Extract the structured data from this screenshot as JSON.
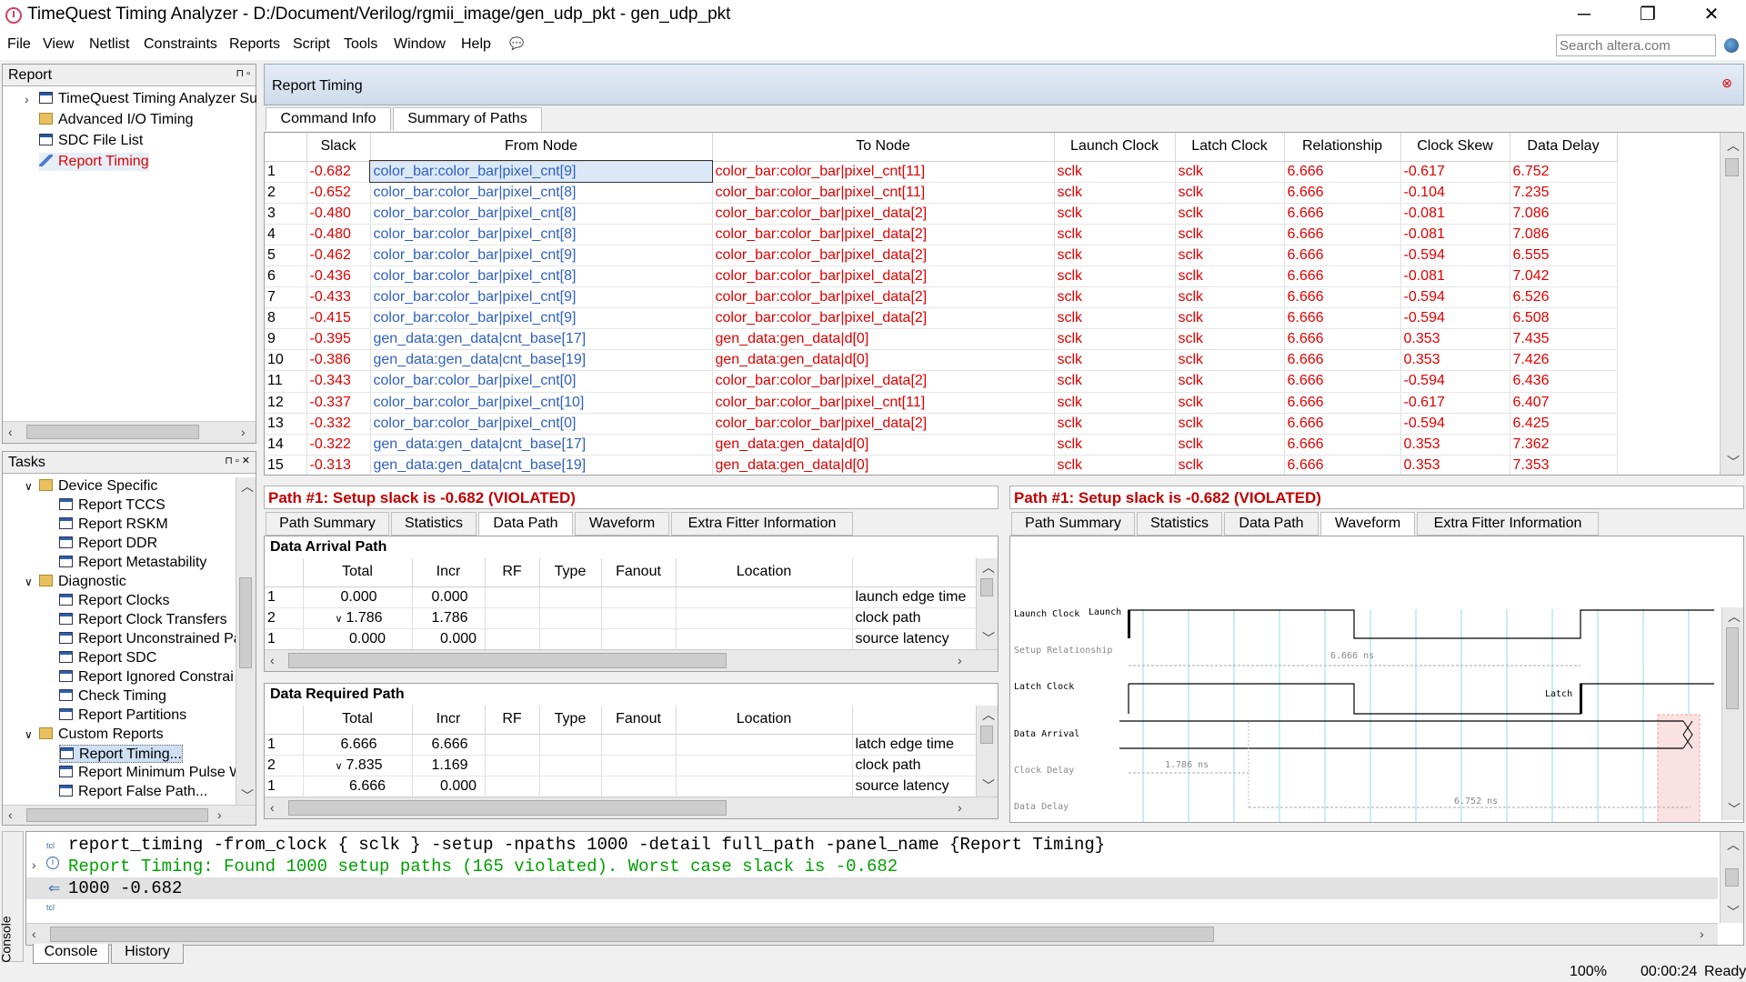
{
  "window": {
    "title": "TimeQuest Timing Analyzer - D:/Document/Verilog/rgmii_image/gen_udp_pkt - gen_udp_pkt",
    "minimize": "─",
    "maximize": "❐",
    "close": "✕"
  },
  "menu": [
    "File",
    "View",
    "Netlist",
    "Constraints",
    "Reports",
    "Script",
    "Tools",
    "Window",
    "Help"
  ],
  "search": {
    "placeholder": "Search altera.com"
  },
  "report_panel": {
    "title": "Report",
    "items": [
      "TimeQuest Timing Analyzer Su",
      "Advanced I/O Timing",
      "SDC File List",
      "Report Timing"
    ]
  },
  "tasks_panel": {
    "title": "Tasks",
    "groups": [
      {
        "label": "Device Specific",
        "items": [
          "Report TCCS",
          "Report RSKM",
          "Report DDR",
          "Report Metastability"
        ]
      },
      {
        "label": "Diagnostic",
        "items": [
          "Report Clocks",
          "Report Clock Transfers",
          "Report Unconstrained Pa",
          "Report SDC",
          "Report Ignored Constrai",
          "Check Timing",
          "Report Partitions"
        ]
      },
      {
        "label": "Custom Reports",
        "items": [
          "Report Timing...",
          "Report Minimum Pulse W",
          "Report False Path..."
        ]
      }
    ]
  },
  "main": {
    "title": "Report Timing",
    "tabs": [
      "Command Info",
      "Summary of Paths"
    ]
  },
  "summary": {
    "columns": [
      "",
      "Slack",
      "From Node",
      "To Node",
      "Launch Clock",
      "Latch Clock",
      "Relationship",
      "Clock Skew",
      "Data Delay"
    ],
    "rows": [
      [
        "1",
        "-0.682",
        "color_bar:color_bar|pixel_cnt[9]",
        "color_bar:color_bar|pixel_cnt[11]",
        "sclk",
        "sclk",
        "6.666",
        "-0.617",
        "6.752"
      ],
      [
        "2",
        "-0.652",
        "color_bar:color_bar|pixel_cnt[8]",
        "color_bar:color_bar|pixel_cnt[11]",
        "sclk",
        "sclk",
        "6.666",
        "-0.104",
        "7.235"
      ],
      [
        "3",
        "-0.480",
        "color_bar:color_bar|pixel_cnt[8]",
        "color_bar:color_bar|pixel_data[2]",
        "sclk",
        "sclk",
        "6.666",
        "-0.081",
        "7.086"
      ],
      [
        "4",
        "-0.480",
        "color_bar:color_bar|pixel_cnt[8]",
        "color_bar:color_bar|pixel_data[2]",
        "sclk",
        "sclk",
        "6.666",
        "-0.081",
        "7.086"
      ],
      [
        "5",
        "-0.462",
        "color_bar:color_bar|pixel_cnt[9]",
        "color_bar:color_bar|pixel_data[2]",
        "sclk",
        "sclk",
        "6.666",
        "-0.594",
        "6.555"
      ],
      [
        "6",
        "-0.436",
        "color_bar:color_bar|pixel_cnt[8]",
        "color_bar:color_bar|pixel_data[2]",
        "sclk",
        "sclk",
        "6.666",
        "-0.081",
        "7.042"
      ],
      [
        "7",
        "-0.433",
        "color_bar:color_bar|pixel_cnt[9]",
        "color_bar:color_bar|pixel_data[2]",
        "sclk",
        "sclk",
        "6.666",
        "-0.594",
        "6.526"
      ],
      [
        "8",
        "-0.415",
        "color_bar:color_bar|pixel_cnt[9]",
        "color_bar:color_bar|pixel_data[2]",
        "sclk",
        "sclk",
        "6.666",
        "-0.594",
        "6.508"
      ],
      [
        "9",
        "-0.395",
        "gen_data:gen_data|cnt_base[17]",
        "gen_data:gen_data|d[0]",
        "sclk",
        "sclk",
        "6.666",
        "0.353",
        "7.435"
      ],
      [
        "10",
        "-0.386",
        "gen_data:gen_data|cnt_base[19]",
        "gen_data:gen_data|d[0]",
        "sclk",
        "sclk",
        "6.666",
        "0.353",
        "7.426"
      ],
      [
        "11",
        "-0.343",
        "color_bar:color_bar|pixel_cnt[0]",
        "color_bar:color_bar|pixel_data[2]",
        "sclk",
        "sclk",
        "6.666",
        "-0.594",
        "6.436"
      ],
      [
        "12",
        "-0.337",
        "color_bar:color_bar|pixel_cnt[10]",
        "color_bar:color_bar|pixel_cnt[11]",
        "sclk",
        "sclk",
        "6.666",
        "-0.617",
        "6.407"
      ],
      [
        "13",
        "-0.332",
        "color_bar:color_bar|pixel_cnt[0]",
        "color_bar:color_bar|pixel_data[2]",
        "sclk",
        "sclk",
        "6.666",
        "-0.594",
        "6.425"
      ],
      [
        "14",
        "-0.322",
        "gen_data:gen_data|cnt_base[17]",
        "gen_data:gen_data|d[0]",
        "sclk",
        "sclk",
        "6.666",
        "0.353",
        "7.362"
      ],
      [
        "15",
        "-0.313",
        "gen_data:gen_data|cnt_base[19]",
        "gen_data:gen_data|d[0]",
        "sclk",
        "sclk",
        "6.666",
        "0.353",
        "7.353"
      ]
    ]
  },
  "path_left": {
    "title": "Path #1: Setup slack is -0.682 (VIOLATED)",
    "tabs": [
      "Path Summary",
      "Statistics",
      "Data Path",
      "Waveform",
      "Extra Fitter Information"
    ],
    "arrival": {
      "title": "Data Arrival Path",
      "columns": [
        "",
        "Total",
        "Incr",
        "RF",
        "Type",
        "Fanout",
        "Location",
        ""
      ],
      "rows": [
        [
          "1",
          "0.000",
          "0.000",
          "",
          "",
          "",
          "",
          "launch edge time"
        ],
        [
          "2",
          "1.786",
          "1.786",
          "",
          "",
          "",
          "",
          "clock path"
        ],
        [
          "1",
          "0.000",
          "0.000",
          "",
          "",
          "",
          "",
          "source latency"
        ]
      ]
    },
    "required": {
      "title": "Data Required Path",
      "columns": [
        "",
        "Total",
        "Incr",
        "RF",
        "Type",
        "Fanout",
        "Location",
        ""
      ],
      "rows": [
        [
          "1",
          "6.666",
          "6.666",
          "",
          "",
          "",
          "",
          "latch edge time"
        ],
        [
          "2",
          "7.835",
          "1.169",
          "",
          "",
          "",
          "",
          "clock path"
        ],
        [
          "1",
          "6.666",
          "0.000",
          "",
          "",
          "",
          "",
          "source latency"
        ]
      ]
    }
  },
  "path_right": {
    "title": "Path #1: Setup slack is -0.682 (VIOLATED)",
    "tabs": [
      "Path Summary",
      "Statistics",
      "Data Path",
      "Waveform",
      "Extra Fitter Information"
    ],
    "wave": {
      "launch_clock": "Launch Clock",
      "launch": "Launch",
      "setup_rel": "Setup Relationship",
      "setup_val": "6.666 ns",
      "latch_clock": "Latch Clock",
      "latch": "Latch",
      "data_arrival": "Data Arrival",
      "clock_delay": "Clock Delay",
      "clock_delay_val": "1.786 ns",
      "data_delay": "Data Delay",
      "data_delay_val": "6.752 ns"
    }
  },
  "console": {
    "lines": [
      "report_timing -from_clock { sclk } -setup -npaths 1000 -detail full_path -panel_name {Report Timing}",
      "Report Timing: Found 1000 setup paths (165 violated).  Worst case slack is -0.682",
      "1000 -0.682"
    ],
    "tabs": [
      "Console",
      "History"
    ],
    "side_label": "Console",
    "tcl": "tcl"
  },
  "status": {
    "zoom": "100%",
    "time": "00:00:24",
    "state": "Ready"
  },
  "colors": {
    "violated": "#e00000",
    "console_green": "#00a000"
  }
}
